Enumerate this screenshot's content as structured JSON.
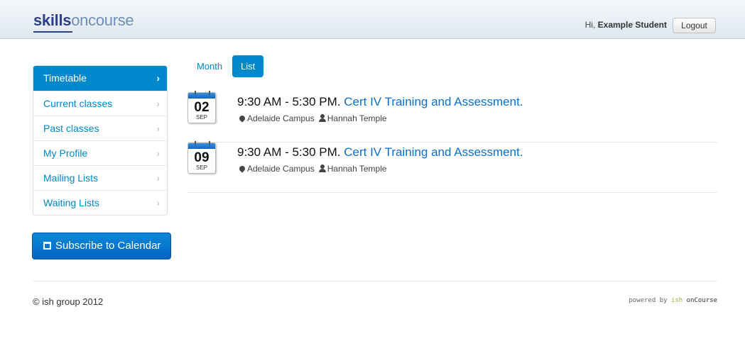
{
  "header": {
    "logo": {
      "skills": "skills",
      "on": "on",
      "course": "course"
    },
    "greeting_prefix": "Hi,",
    "user_name": "Example Student",
    "logout_label": "Logout"
  },
  "sidebar": {
    "items": [
      {
        "label": "Timetable",
        "active": true
      },
      {
        "label": "Current classes",
        "active": false
      },
      {
        "label": "Past classes",
        "active": false
      },
      {
        "label": "My Profile",
        "active": false
      },
      {
        "label": "Mailing Lists",
        "active": false
      },
      {
        "label": "Waiting Lists",
        "active": false
      }
    ],
    "subscribe_label": "Subscribe to Calendar"
  },
  "tabs": [
    {
      "label": "Month",
      "active": false
    },
    {
      "label": "List",
      "active": true
    }
  ],
  "events": [
    {
      "day": "02",
      "month": "SEP",
      "time": "9:30 AM - 5:30 PM.",
      "course": "Cert IV Training and Assessment.",
      "location": "Adelaide Campus",
      "tutor": "Hannah Temple"
    },
    {
      "day": "09",
      "month": "SEP",
      "time": "9:30 AM - 5:30 PM.",
      "course": "Cert IV Training and Assessment.",
      "location": "Adelaide Campus",
      "tutor": "Hannah Temple"
    }
  ],
  "footer": {
    "copyright": "© ish group 2012",
    "powered_prefix": "powered by",
    "powered_ish": "ish",
    "powered_product": "onCourse"
  },
  "colors": {
    "accent": "#0088cc",
    "link": "#0a6fd0",
    "logo_dark": "#2e3f87",
    "logo_light": "#6f8eb8"
  }
}
